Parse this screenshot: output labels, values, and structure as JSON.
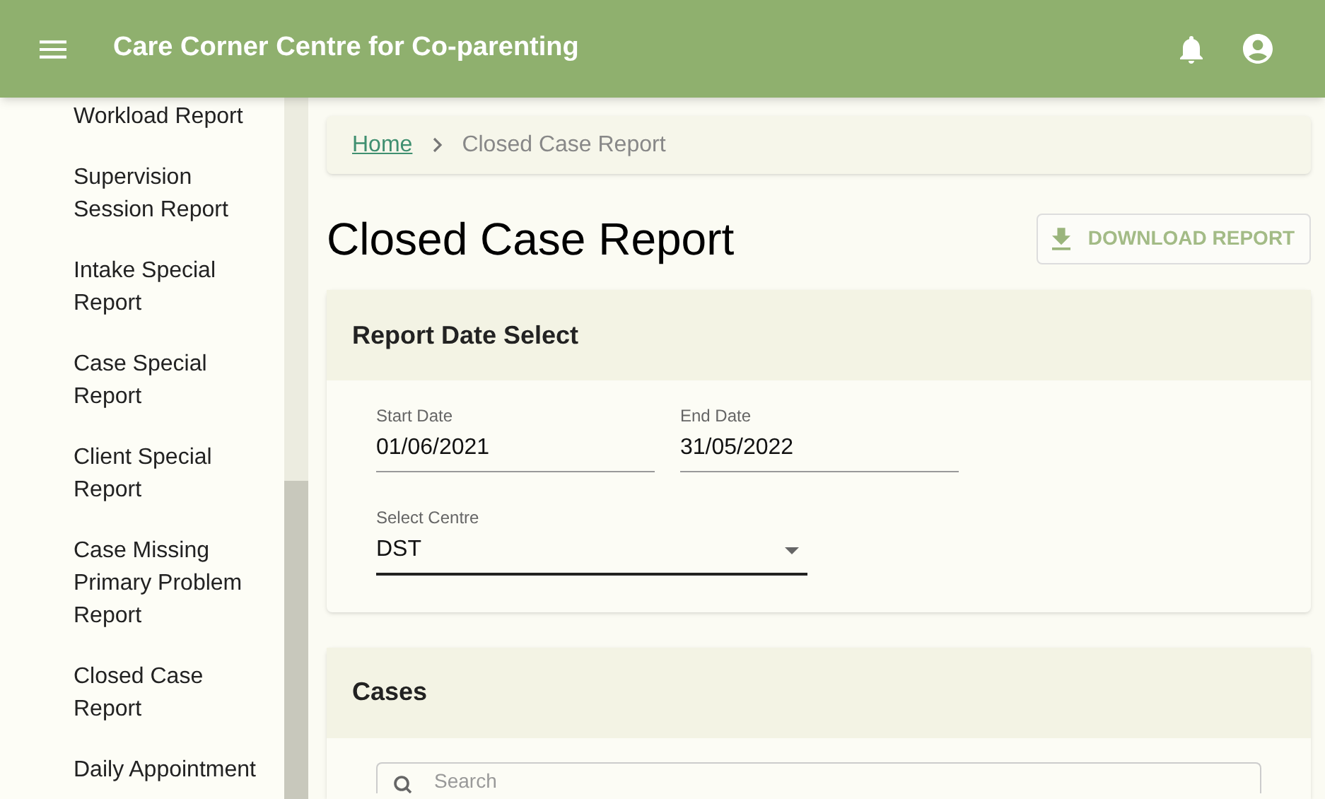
{
  "app_bar": {
    "title": "Care Corner Centre for Co-parenting"
  },
  "sidebar": {
    "items": [
      {
        "label": "Workload Report"
      },
      {
        "label": "Supervision Session Report"
      },
      {
        "label": "Intake Special Report"
      },
      {
        "label": "Case Special Report"
      },
      {
        "label": "Client Special Report"
      },
      {
        "label": "Case Missing Primary Problem Report"
      },
      {
        "label": "Closed Case Report"
      },
      {
        "label": "Daily Appointment"
      }
    ]
  },
  "breadcrumb": [
    {
      "label": "Home",
      "kind": "link"
    },
    {
      "label": "Closed Case Report",
      "kind": "current"
    }
  ],
  "page_title": "Closed Case Report",
  "download_button": "DOWNLOAD REPORT",
  "report_date_card": {
    "title": "Report Date Select",
    "start_date": {
      "label": "Start Date",
      "value": "01/06/2021"
    },
    "end_date": {
      "label": "End Date",
      "value": "31/05/2022"
    },
    "centre": {
      "label": "Select Centre",
      "value": "DST"
    }
  },
  "cases_card": {
    "title": "Cases",
    "search": {
      "placeholder": "Search"
    }
  }
}
